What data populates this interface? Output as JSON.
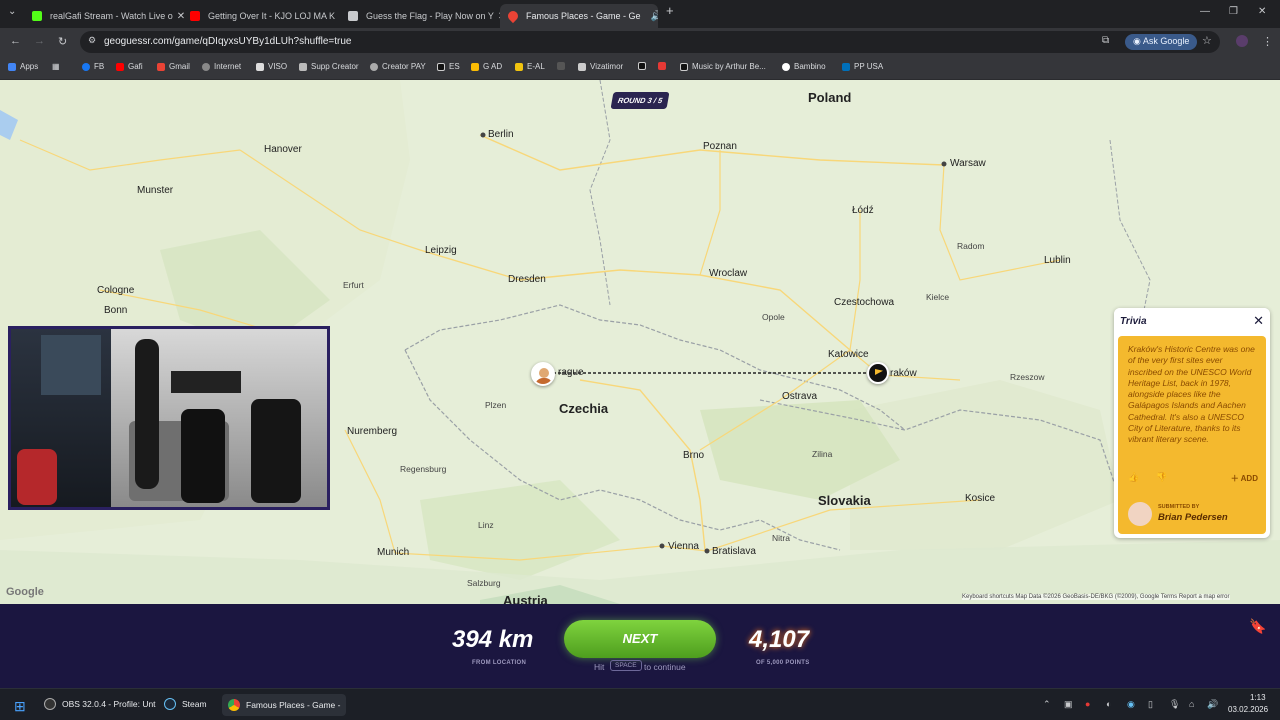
{
  "browser": {
    "tabs": [
      {
        "title": "realGafi Stream - Watch Live o",
        "favicon_color": "#53fc18"
      },
      {
        "title": "Getting Over It - KJO LOJ MA K",
        "favicon_color": "#ff0000"
      },
      {
        "title": "Guess the Flag - Play Now on Y",
        "favicon_color": "#c8cacd"
      },
      {
        "title": "Famous Places - Game - Ge",
        "favicon_color": "#ea4335"
      }
    ],
    "url": "geoguessr.com/game/qDIqyxsUYBy1dLUh?shuffle=true",
    "ask_google": "Ask Google",
    "bookmarks": [
      {
        "label": "Apps"
      },
      {
        "label": "FB"
      },
      {
        "label": "Gafi"
      },
      {
        "label": "Gmail"
      },
      {
        "label": "Internet"
      },
      {
        "label": "VISO"
      },
      {
        "label": "Supp Creator"
      },
      {
        "label": "Creator PAY"
      },
      {
        "label": "ES"
      },
      {
        "label": "G AD"
      },
      {
        "label": "E-AL"
      },
      {
        "label": "Vizatimor"
      },
      {
        "label": "Music by Arthur Be..."
      },
      {
        "label": "Bambino"
      },
      {
        "label": "PP USA"
      }
    ]
  },
  "game": {
    "round": "ROUND 3 / 5",
    "distance": "394 km",
    "distance_sub": "FROM LOCATION",
    "next_label": "NEXT",
    "hint_hit": "Hit",
    "hint_key": "SPACE",
    "hint_continue": "to continue",
    "points": "4,107",
    "points_sub": "OF 5,000 POINTS"
  },
  "trivia": {
    "title": "Trivia",
    "text": "Kraków's Historic Centre was one of the very first sites ever inscribed on the UNESCO World Heritage List, back in 1978, alongside places like the Galápagos Islands and Aachen Cathedral. It's also a UNESCO City of Literature, thanks to its vibrant literary scene.",
    "add_label": "ADD",
    "submitted_by_label": "SUBMITTED BY",
    "submitter": "Brian Pedersen"
  },
  "map": {
    "countries": [
      "Poland",
      "Czechia",
      "Slovakia",
      "Austria"
    ],
    "cities": [
      "Berlin",
      "Hanover",
      "Leipzig",
      "Dresden",
      "Poznan",
      "Wroclaw",
      "Warsaw",
      "Łódź",
      "Lublin",
      "Katowice",
      "Ostrava",
      "Brno",
      "Vienna",
      "Bratislava",
      "Munich",
      "Nuremberg",
      "Cologne",
      "Bonn",
      "Munster",
      "Erfurt",
      "Kosice",
      "Czestochowa",
      "Radom",
      "Rzeszow",
      "Kielce",
      "Opole",
      "Plzen",
      "Zilina",
      "Nitra",
      "Linz",
      "Regensburg",
      "Salzburg"
    ],
    "guess_label": "rague",
    "answer_label": "raków",
    "google": "Google",
    "attribution": "Keyboard shortcuts   Map Data ©2026 GeoBasis-DE/BKG (©2009), Google   Terms   Report a map error"
  },
  "taskbar": {
    "items": [
      "OBS 32.0.4 - Profile: Unt",
      "Steam",
      "Famous Places - Game -"
    ],
    "time": "1:13",
    "date": "03.02.2026"
  }
}
